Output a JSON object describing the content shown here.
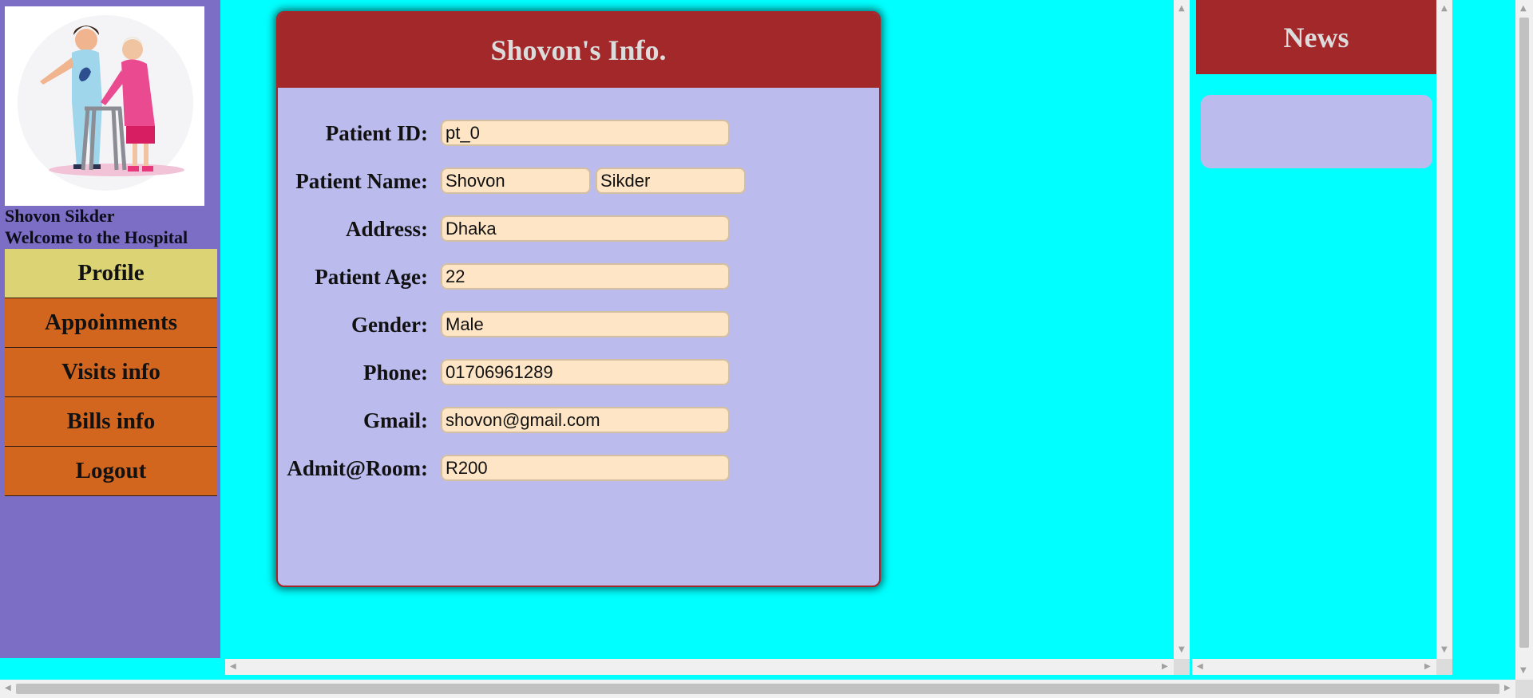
{
  "sidebar": {
    "user_name": "Shovon Sikder",
    "welcome": "Welcome to the Hospital",
    "nav": [
      {
        "label": "Profile",
        "active": true
      },
      {
        "label": "Appoinments",
        "active": false
      },
      {
        "label": "Visits info",
        "active": false
      },
      {
        "label": "Bills info",
        "active": false
      },
      {
        "label": "Logout",
        "active": false
      }
    ]
  },
  "card": {
    "title": "Shovon's Info.",
    "fields": {
      "patient_id": {
        "label": "Patient ID:",
        "value": "pt_0"
      },
      "patient_name": {
        "label": "Patient Name:",
        "first": "Shovon",
        "last": "Sikder"
      },
      "address": {
        "label": "Address:",
        "value": "Dhaka"
      },
      "age": {
        "label": "Patient Age:",
        "value": "22"
      },
      "gender": {
        "label": "Gender:",
        "value": "Male"
      },
      "phone": {
        "label": "Phone:",
        "value": "01706961289"
      },
      "gmail": {
        "label": "Gmail:",
        "value": "shovon@gmail.com"
      },
      "room": {
        "label": "Admit@Room:",
        "value": "R200"
      }
    }
  },
  "news": {
    "title": "News"
  },
  "colors": {
    "background": "#00ffff",
    "sidebar": "#7b6ec4",
    "nav_active": "#dcd474",
    "nav_item": "#d2661e",
    "header": "#a3282a",
    "card_body": "#bbbbee",
    "input": "#fde5c6"
  },
  "icons": {
    "avatar": "nurse-and-elderly-patient-illustration",
    "scroll_up": "arrow-up-icon",
    "scroll_down": "arrow-down-icon",
    "scroll_left": "arrow-left-icon",
    "scroll_right": "arrow-right-icon"
  }
}
